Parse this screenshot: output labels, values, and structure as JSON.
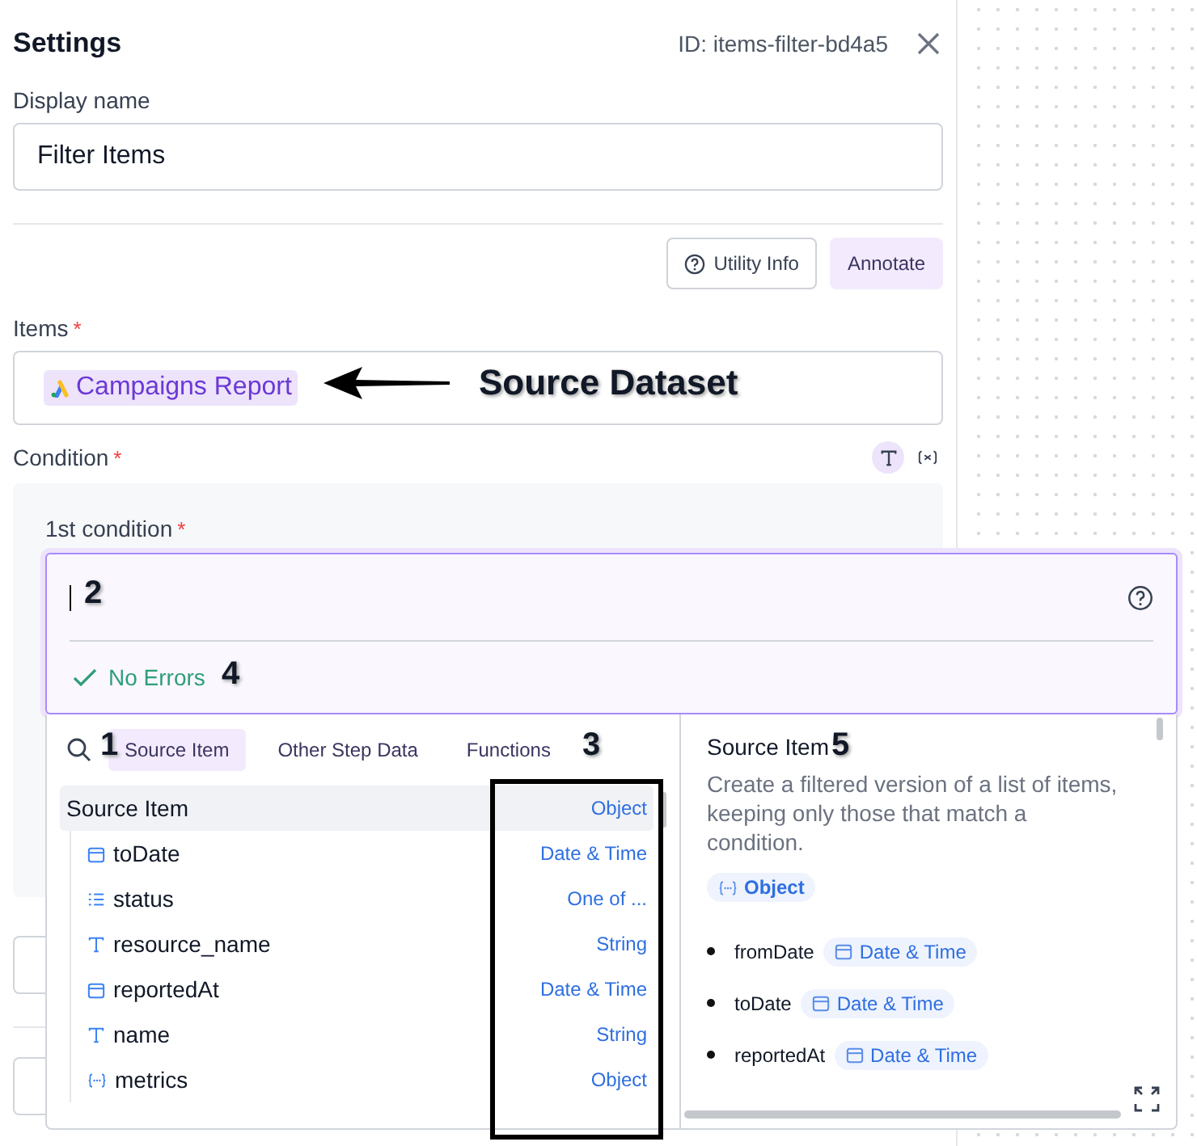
{
  "header": {
    "title": "Settings",
    "id_text": "ID: items-filter-bd4a5"
  },
  "display_name": {
    "label": "Display name",
    "value": "Filter Items"
  },
  "actions": [
    {
      "kind": "info",
      "label": "Utility Info"
    },
    {
      "kind": "accent",
      "label": "Annotate"
    }
  ],
  "items_field": {
    "label": "Items",
    "required_mark": "*",
    "chip": "Campaigns Report"
  },
  "condition": {
    "label": "Condition",
    "required_mark": "*",
    "modes": [
      {
        "kind": "text",
        "selected": true
      },
      {
        "kind": "variable",
        "selected": false
      }
    ],
    "first_label": "1st condition",
    "first_required_mark": "*"
  },
  "editor": {
    "status": "No Errors"
  },
  "picker": {
    "tabs": [
      {
        "label": "Source Item",
        "selected": true
      },
      {
        "label": "Other Step Data",
        "selected": false
      },
      {
        "label": "Functions",
        "selected": false
      }
    ],
    "root": {
      "name": "Source Item",
      "type": "Object",
      "selected": true
    },
    "children": [
      {
        "kind": "date",
        "name": "toDate",
        "type": "Date & Time"
      },
      {
        "kind": "enum",
        "name": "status",
        "type": "One of ..."
      },
      {
        "kind": "string",
        "name": "resource_name",
        "type": "String"
      },
      {
        "kind": "date",
        "name": "reportedAt",
        "type": "Date & Time"
      },
      {
        "kind": "string",
        "name": "name",
        "type": "String"
      },
      {
        "kind": "object",
        "name": "metrics",
        "type": "Object"
      }
    ]
  },
  "detail": {
    "title": "Source Item",
    "description": "Create a filtered version of a list of items, keeping only those that match a condition.",
    "type_badge": {
      "kind": "object",
      "label": "Object"
    },
    "fields": [
      {
        "kind": "date",
        "name": "fromDate",
        "type": "Date & Time"
      },
      {
        "kind": "date",
        "name": "toDate",
        "type": "Date & Time"
      },
      {
        "kind": "date",
        "name": "reportedAt",
        "type": "Date & Time"
      }
    ]
  },
  "annotations": {
    "arrow_label": "Source Dataset",
    "markers": [
      "1",
      "2",
      "3",
      "4",
      "5"
    ]
  }
}
